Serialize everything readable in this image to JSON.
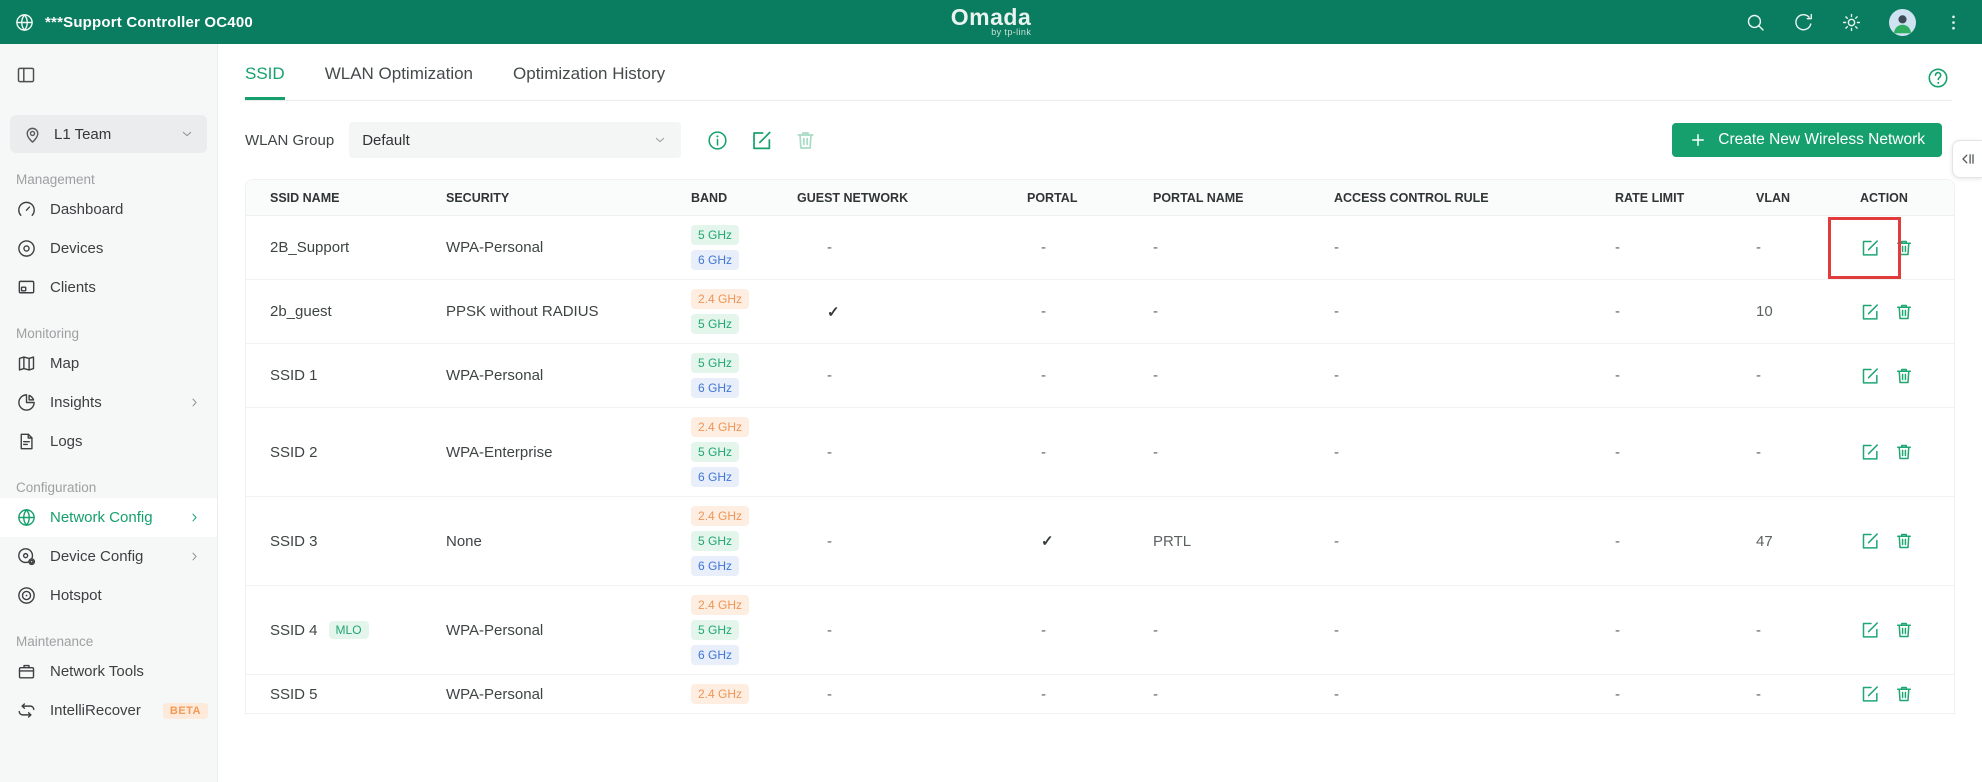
{
  "topbar": {
    "title": "***Support Controller OC400",
    "brand": "Omada",
    "brand_sub": "by tp-link",
    "bar_color": "#0a7c60"
  },
  "sidebar": {
    "site": {
      "label": "L1 Team"
    },
    "sections": [
      {
        "label": "Management",
        "items": [
          {
            "label": "Dashboard",
            "icon": "dashboard-icon"
          },
          {
            "label": "Devices",
            "icon": "devices-icon"
          },
          {
            "label": "Clients",
            "icon": "clients-icon"
          }
        ]
      },
      {
        "label": "Monitoring",
        "items": [
          {
            "label": "Map",
            "icon": "map-icon"
          },
          {
            "label": "Insights",
            "icon": "insights-icon",
            "chevron": true
          },
          {
            "label": "Logs",
            "icon": "logs-icon"
          }
        ]
      },
      {
        "label": "Configuration",
        "items": [
          {
            "label": "Network Config",
            "icon": "network-config-icon",
            "chevron": true,
            "active": true
          },
          {
            "label": "Device Config",
            "icon": "device-config-icon",
            "chevron": true
          },
          {
            "label": "Hotspot",
            "icon": "hotspot-icon"
          }
        ]
      },
      {
        "label": "Maintenance",
        "items": [
          {
            "label": "Network Tools",
            "icon": "network-tools-icon"
          },
          {
            "label": "IntelliRecover",
            "icon": "intellirecover-icon",
            "badge": "BETA"
          }
        ]
      }
    ]
  },
  "main": {
    "tabs": [
      {
        "label": "SSID",
        "active": true
      },
      {
        "label": "WLAN Optimization",
        "active": false
      },
      {
        "label": "Optimization History",
        "active": false
      }
    ],
    "wlan_group": {
      "label": "WLAN Group",
      "selected": "Default"
    },
    "create_button": "Create New Wireless Network",
    "table": {
      "columns": [
        "SSID NAME",
        "SECURITY",
        "BAND",
        "GUEST NETWORK",
        "PORTAL",
        "PORTAL NAME",
        "ACCESS CONTROL RULE",
        "RATE LIMIT",
        "VLAN",
        "ACTION"
      ],
      "rows": [
        {
          "ssid": "2B_Support",
          "tag": "",
          "security": "WPA-Personal",
          "bands": [
            "5 GHz",
            "6 GHz"
          ],
          "guest": "-",
          "portal": "-",
          "portal_name": "-",
          "acl": "-",
          "rate": "-",
          "vlan": "-",
          "highlight_edit": true
        },
        {
          "ssid": "2b_guest",
          "tag": "",
          "security": "PPSK without RADIUS",
          "bands": [
            "2.4 GHz",
            "5 GHz"
          ],
          "guest": "✓",
          "portal": "-",
          "portal_name": "-",
          "acl": "-",
          "rate": "-",
          "vlan": "10",
          "highlight_edit": false
        },
        {
          "ssid": "SSID 1",
          "tag": "",
          "security": "WPA-Personal",
          "bands": [
            "5 GHz",
            "6 GHz"
          ],
          "guest": "-",
          "portal": "-",
          "portal_name": "-",
          "acl": "-",
          "rate": "-",
          "vlan": "-",
          "highlight_edit": false
        },
        {
          "ssid": "SSID 2",
          "tag": "",
          "security": "WPA-Enterprise",
          "bands": [
            "2.4 GHz",
            "5 GHz",
            "6 GHz"
          ],
          "guest": "-",
          "portal": "-",
          "portal_name": "-",
          "acl": "-",
          "rate": "-",
          "vlan": "-",
          "highlight_edit": false
        },
        {
          "ssid": "SSID 3",
          "tag": "",
          "security": "None",
          "bands": [
            "2.4 GHz",
            "5 GHz",
            "6 GHz"
          ],
          "guest": "-",
          "portal": "✓",
          "portal_name": "PRTL",
          "acl": "-",
          "rate": "-",
          "vlan": "47",
          "highlight_edit": false
        },
        {
          "ssid": "SSID 4",
          "tag": "MLO",
          "security": "WPA-Personal",
          "bands": [
            "2.4 GHz",
            "5 GHz",
            "6 GHz"
          ],
          "guest": "-",
          "portal": "-",
          "portal_name": "-",
          "acl": "-",
          "rate": "-",
          "vlan": "-",
          "highlight_edit": false
        },
        {
          "ssid": "SSID 5",
          "tag": "",
          "security": "WPA-Personal",
          "bands": [
            "2.4 GHz"
          ],
          "guest": "-",
          "portal": "-",
          "portal_name": "-",
          "acl": "-",
          "rate": "-",
          "vlan": "-",
          "highlight_edit": false
        }
      ]
    },
    "colors": {
      "accent_green": "#15a06d",
      "band_24": "#f09455",
      "band_5": "#1fa673",
      "band_6": "#4076d6",
      "beta_orange": "#f29a56",
      "annotation_red": "#e23b3b"
    }
  }
}
